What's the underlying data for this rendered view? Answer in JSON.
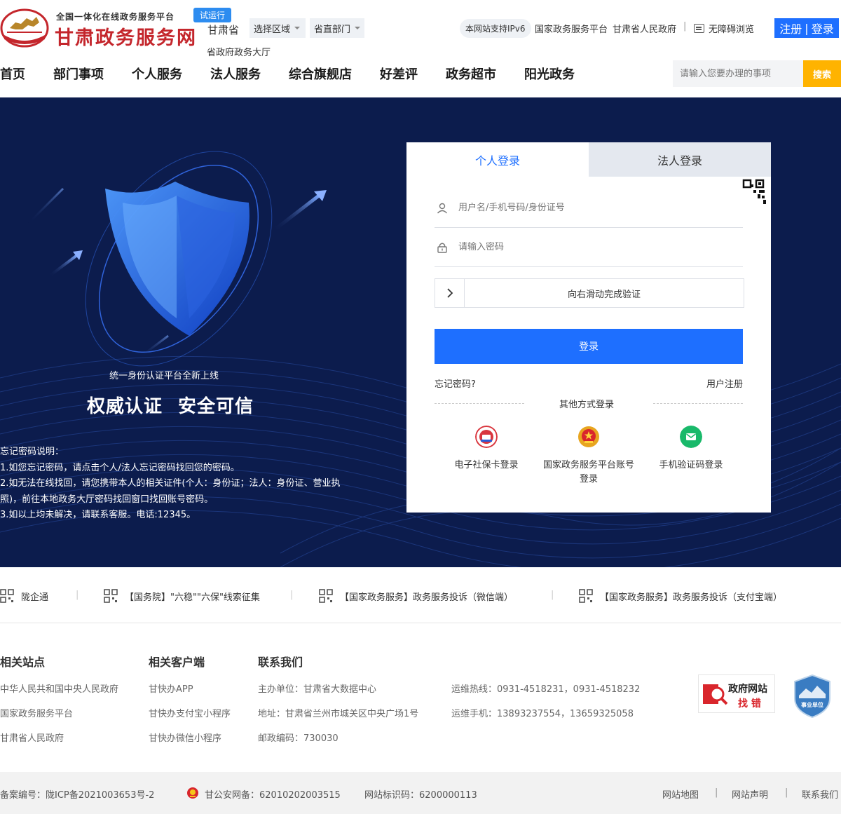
{
  "header": {
    "slogan": "全国一体化在线政务服务平台",
    "site_title": "甘肃政务服务网",
    "trial_badge": "试运行",
    "province": "甘肃省",
    "select_area": "选择区域",
    "select_dept": "省直部门",
    "hall_link": "省政府政务大厅",
    "ipv6": "本网站支持IPv6",
    "national_platform": "国家政务服务平台",
    "gansu_gov": "甘肃省人民政府",
    "separator": "|",
    "accessibility": "无障碍浏览",
    "register": "注册",
    "auth_sep": "|",
    "login": "登录"
  },
  "nav": {
    "items": [
      "首页",
      "部门事项",
      "个人服务",
      "法人服务",
      "综合旗舰店",
      "好差评",
      "政务超市",
      "阳光政务"
    ],
    "search_placeholder": "请输入您要办理的事项",
    "search_button": "搜索"
  },
  "banner": {
    "subtitle": "统一身份认证平台全新上线",
    "title_a": "权威认证",
    "title_b": "安全可信",
    "help_title": "忘记密码说明：",
    "help_lines": [
      "1.如您忘记密码，请点击个人/法人忘记密码找回您的密码。",
      "2.如无法在线找回，请您携带本人的相关证件(个人：身份证；法人：身份证、营业执照)，前往本地政务大厅密码找回窗口找回账号密码。",
      "3.如以上均未解决，请联系客服。电话:12345。"
    ]
  },
  "login": {
    "tab_personal": "个人登录",
    "tab_legal": "法人登录",
    "username_placeholder": "用户名/手机号码/身份证号",
    "password_placeholder": "请输入密码",
    "slider_text": "向右滑动完成验证",
    "login_button": "登录",
    "forgot": "忘记密码?",
    "register": "用户注册",
    "other_methods": "其他方式登录",
    "alt_social_card": "电子社保卡登录",
    "alt_national": "国家政务服务平台账号登录",
    "alt_sms": "手机验证码登录"
  },
  "strip": {
    "items": [
      "陇企通",
      "【国务院】\"六稳\"\"六保\"线索征集",
      "【国家政务服务】政务服务投诉（微信端）",
      "【国家政务服务】政务服务投诉（支付宝端）"
    ],
    "sep": "|"
  },
  "footer": {
    "col1_title": "相关站点",
    "col1_links": [
      "中华人民共和国中央人民政府",
      "国家政务服务平台",
      "甘肃省人民政府"
    ],
    "col2_title": "相关客户端",
    "col2_links": [
      "甘快办APP",
      "甘快办支付宝小程序",
      "甘快办微信小程序"
    ],
    "col3_title": "联系我们",
    "col3_lines": [
      "主办单位：甘肃省大数据中心",
      "地址：甘肃省兰州市城关区中央广场1号",
      "邮政编码：730030"
    ],
    "col4_lines": [
      "运维热线：0931-4518231，0931-4518232",
      "运维手机：13893237554，13659325058"
    ],
    "gov_badge_line1": "政府网站",
    "gov_badge_line2": "找 错",
    "unit_badge": "事业单位"
  },
  "bottom": {
    "icp": "备案编号：陇ICP备2021003653号-2",
    "police": "甘公安网备：62010202003515",
    "site_code": "网站标识码：6200000113",
    "sitemap": "网站地图",
    "statement": "网站声明",
    "contact": "联系我们",
    "sep": "|"
  },
  "colors": {
    "brand_red": "#c4262c",
    "primary_blue": "#1e6fff",
    "banner_navy": "#0c1c4d",
    "search_yellow": "#ffb300"
  }
}
